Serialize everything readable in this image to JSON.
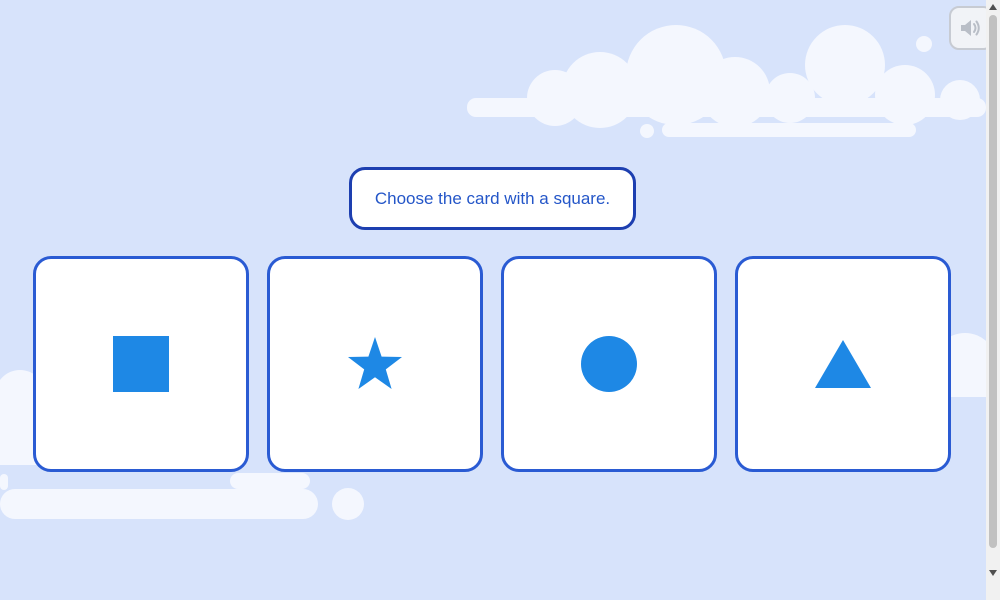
{
  "prompt": {
    "text": "Choose the card with a square."
  },
  "sound_button": {
    "icon": "speaker-icon"
  },
  "cards": [
    {
      "shape": "square",
      "icon": "square-icon"
    },
    {
      "shape": "star",
      "icon": "star-icon"
    },
    {
      "shape": "circle",
      "icon": "circle-icon"
    },
    {
      "shape": "triangle",
      "icon": "triangle-icon"
    }
  ],
  "colors": {
    "background": "#d7e3fb",
    "cloud": "#f4f7fe",
    "shape_fill": "#1e88e5",
    "card_border": "#2a5bd3",
    "prompt_border": "#1d3fb0",
    "prompt_text": "#2456c8"
  }
}
